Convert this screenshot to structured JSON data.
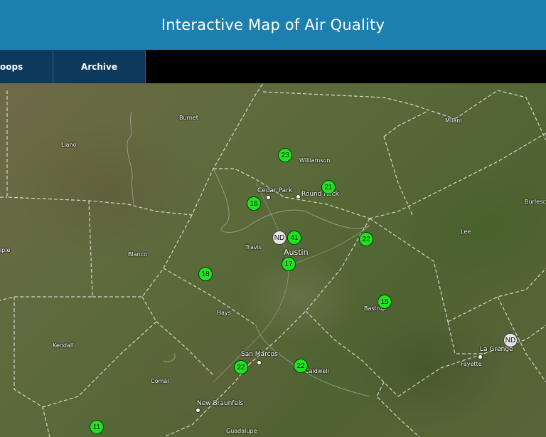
{
  "header": {
    "title": "Interactive Map of Air Quality"
  },
  "nav": {
    "tabs": [
      {
        "label": "oops"
      },
      {
        "label": "Archive"
      }
    ]
  },
  "map": {
    "counties": [
      "Burnet",
      "Llano",
      "Williamson",
      "Milam",
      "Burlesc",
      "Travis",
      "Blanco",
      "ipie",
      "Lee",
      "Hays",
      "Bastrop",
      "Kendall",
      "Comal",
      "Caldwell",
      "Fayette",
      "Guadalupe"
    ],
    "cities": [
      "Cedar Park",
      "Round Rock",
      "Austin",
      "San Marcos",
      "La Grange",
      "New Braunfels"
    ],
    "readings": [
      "23",
      "21",
      "16",
      "41",
      "ND",
      "22",
      "17",
      "18",
      "15",
      "22",
      "22",
      "ND",
      "11"
    ]
  },
  "colors": {
    "header_bg": "#1b7fb0",
    "tab_bg": "#0d3a5c",
    "good": "#1ee61e",
    "no_data": "#e6e6e6"
  }
}
